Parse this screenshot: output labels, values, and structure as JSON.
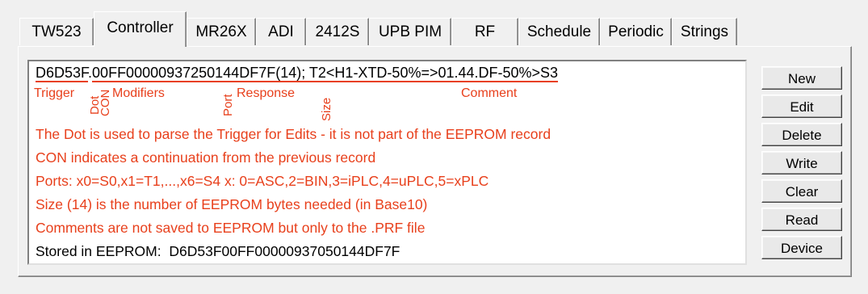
{
  "tabs": [
    {
      "label": "TW523",
      "active": false
    },
    {
      "label": "Controller",
      "active": true
    },
    {
      "label": "MR26X",
      "active": false
    },
    {
      "label": "ADI",
      "active": false
    },
    {
      "label": "2412S",
      "active": false
    },
    {
      "label": "UPB PIM",
      "active": false
    },
    {
      "label": "RF",
      "active": false
    },
    {
      "label": "Schedule",
      "active": false
    },
    {
      "label": "Periodic",
      "active": false
    },
    {
      "label": "Strings",
      "active": false
    }
  ],
  "record": {
    "trigger": "D6D53F",
    "dot": ".",
    "modifiers": "00FF0000093725",
    "response": "0144DF7F",
    "size": "(14)",
    "comment": "; T2<H1-XTD-50%=>01.44.DF-50%>S3"
  },
  "legend": {
    "trigger": "Trigger",
    "dot": "Dot",
    "con": "CON",
    "modifiers": "Modifiers",
    "port": "Port",
    "response": "Response",
    "size": "Size",
    "comment": "Comment"
  },
  "notes": [
    "The Dot is used to parse the Trigger for Edits - it is not part of the EEPROM record",
    "CON indicates a continuation from the previous record",
    "Ports: x0=S0,x1=T1,...,x6=S4  x: 0=ASC,2=BIN,3=iPLC,4=uPLC,5=xPLC",
    "Size (14) is the number of EEPROM bytes needed (in Base10)",
    "Comments are not saved to EEPROM but only to the .PRF file"
  ],
  "stored": {
    "label": "Stored in EEPROM:",
    "value": "D6D53F00FF00000937050144DF7F"
  },
  "buttons": [
    "New",
    "Edit",
    "Delete",
    "Write",
    "Clear",
    "Read",
    "Device"
  ],
  "colors": {
    "annotation": "#e8401c",
    "background": "#f0f0f0",
    "textbox": "#ffffff"
  }
}
